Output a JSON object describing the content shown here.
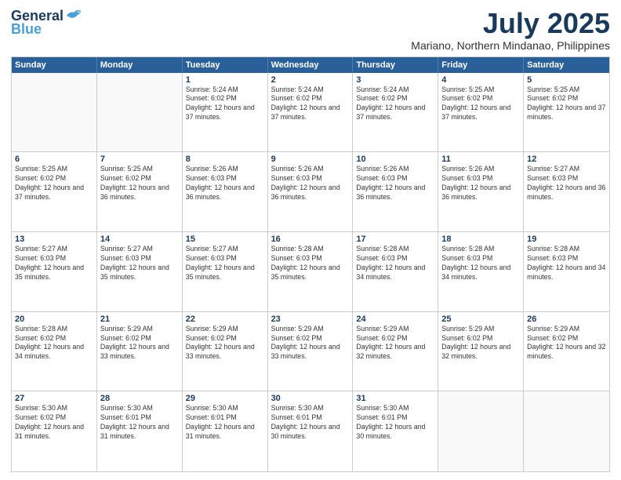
{
  "header": {
    "logo_general": "General",
    "logo_blue": "Blue",
    "month_year": "July 2025",
    "location": "Mariano, Northern Mindanao, Philippines"
  },
  "weekdays": [
    "Sunday",
    "Monday",
    "Tuesday",
    "Wednesday",
    "Thursday",
    "Friday",
    "Saturday"
  ],
  "weeks": [
    [
      {
        "day": "",
        "empty": true
      },
      {
        "day": "",
        "empty": true
      },
      {
        "day": "1",
        "info": "Sunrise: 5:24 AM\nSunset: 6:02 PM\nDaylight: 12 hours and 37 minutes."
      },
      {
        "day": "2",
        "info": "Sunrise: 5:24 AM\nSunset: 6:02 PM\nDaylight: 12 hours and 37 minutes."
      },
      {
        "day": "3",
        "info": "Sunrise: 5:24 AM\nSunset: 6:02 PM\nDaylight: 12 hours and 37 minutes."
      },
      {
        "day": "4",
        "info": "Sunrise: 5:25 AM\nSunset: 6:02 PM\nDaylight: 12 hours and 37 minutes."
      },
      {
        "day": "5",
        "info": "Sunrise: 5:25 AM\nSunset: 6:02 PM\nDaylight: 12 hours and 37 minutes."
      }
    ],
    [
      {
        "day": "6",
        "info": "Sunrise: 5:25 AM\nSunset: 6:02 PM\nDaylight: 12 hours and 37 minutes."
      },
      {
        "day": "7",
        "info": "Sunrise: 5:25 AM\nSunset: 6:02 PM\nDaylight: 12 hours and 36 minutes."
      },
      {
        "day": "8",
        "info": "Sunrise: 5:26 AM\nSunset: 6:03 PM\nDaylight: 12 hours and 36 minutes."
      },
      {
        "day": "9",
        "info": "Sunrise: 5:26 AM\nSunset: 6:03 PM\nDaylight: 12 hours and 36 minutes."
      },
      {
        "day": "10",
        "info": "Sunrise: 5:26 AM\nSunset: 6:03 PM\nDaylight: 12 hours and 36 minutes."
      },
      {
        "day": "11",
        "info": "Sunrise: 5:26 AM\nSunset: 6:03 PM\nDaylight: 12 hours and 36 minutes."
      },
      {
        "day": "12",
        "info": "Sunrise: 5:27 AM\nSunset: 6:03 PM\nDaylight: 12 hours and 36 minutes."
      }
    ],
    [
      {
        "day": "13",
        "info": "Sunrise: 5:27 AM\nSunset: 6:03 PM\nDaylight: 12 hours and 35 minutes."
      },
      {
        "day": "14",
        "info": "Sunrise: 5:27 AM\nSunset: 6:03 PM\nDaylight: 12 hours and 35 minutes."
      },
      {
        "day": "15",
        "info": "Sunrise: 5:27 AM\nSunset: 6:03 PM\nDaylight: 12 hours and 35 minutes."
      },
      {
        "day": "16",
        "info": "Sunrise: 5:28 AM\nSunset: 6:03 PM\nDaylight: 12 hours and 35 minutes."
      },
      {
        "day": "17",
        "info": "Sunrise: 5:28 AM\nSunset: 6:03 PM\nDaylight: 12 hours and 34 minutes."
      },
      {
        "day": "18",
        "info": "Sunrise: 5:28 AM\nSunset: 6:03 PM\nDaylight: 12 hours and 34 minutes."
      },
      {
        "day": "19",
        "info": "Sunrise: 5:28 AM\nSunset: 6:03 PM\nDaylight: 12 hours and 34 minutes."
      }
    ],
    [
      {
        "day": "20",
        "info": "Sunrise: 5:28 AM\nSunset: 6:02 PM\nDaylight: 12 hours and 34 minutes."
      },
      {
        "day": "21",
        "info": "Sunrise: 5:29 AM\nSunset: 6:02 PM\nDaylight: 12 hours and 33 minutes."
      },
      {
        "day": "22",
        "info": "Sunrise: 5:29 AM\nSunset: 6:02 PM\nDaylight: 12 hours and 33 minutes."
      },
      {
        "day": "23",
        "info": "Sunrise: 5:29 AM\nSunset: 6:02 PM\nDaylight: 12 hours and 33 minutes."
      },
      {
        "day": "24",
        "info": "Sunrise: 5:29 AM\nSunset: 6:02 PM\nDaylight: 12 hours and 32 minutes."
      },
      {
        "day": "25",
        "info": "Sunrise: 5:29 AM\nSunset: 6:02 PM\nDaylight: 12 hours and 32 minutes."
      },
      {
        "day": "26",
        "info": "Sunrise: 5:29 AM\nSunset: 6:02 PM\nDaylight: 12 hours and 32 minutes."
      }
    ],
    [
      {
        "day": "27",
        "info": "Sunrise: 5:30 AM\nSunset: 6:02 PM\nDaylight: 12 hours and 31 minutes."
      },
      {
        "day": "28",
        "info": "Sunrise: 5:30 AM\nSunset: 6:01 PM\nDaylight: 12 hours and 31 minutes."
      },
      {
        "day": "29",
        "info": "Sunrise: 5:30 AM\nSunset: 6:01 PM\nDaylight: 12 hours and 31 minutes."
      },
      {
        "day": "30",
        "info": "Sunrise: 5:30 AM\nSunset: 6:01 PM\nDaylight: 12 hours and 30 minutes."
      },
      {
        "day": "31",
        "info": "Sunrise: 5:30 AM\nSunset: 6:01 PM\nDaylight: 12 hours and 30 minutes."
      },
      {
        "day": "",
        "empty": true
      },
      {
        "day": "",
        "empty": true
      }
    ]
  ]
}
